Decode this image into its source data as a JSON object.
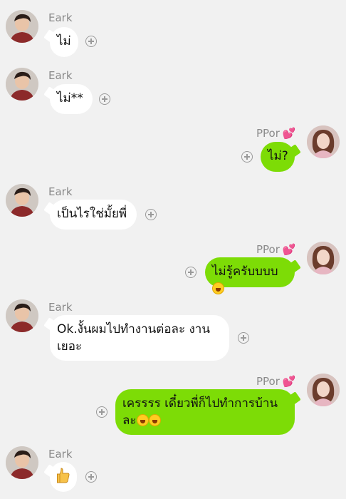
{
  "messages": [
    {
      "sender": "Eark",
      "text": "ไม่"
    },
    {
      "sender": "Eark",
      "text": "ไม่**"
    },
    {
      "sender": "PPor",
      "text": "ไม่?"
    },
    {
      "sender": "Eark",
      "text": "เป็นไรใช่มั้ยพี่"
    },
    {
      "sender": "PPor",
      "text": "ไม่รู้ครับบบบ",
      "emoji": "grinning-sweat-emoji"
    },
    {
      "sender": "Eark",
      "text": "Ok.งั้นผมไปทำงานต่อละ งาน",
      "text2": "เยอะ"
    },
    {
      "sender": "PPor",
      "text": "เครรรร เดี๋ยวพี่ก็ไปทำการบ้าน",
      "text2": "ละ",
      "emoji": "laughing-emoji"
    },
    {
      "sender": "Eark",
      "emoji": "thumbs-up-emoji"
    }
  ],
  "colors": {
    "outgoing": "#7ddc06",
    "incoming": "#ffffff",
    "background": "#f1f1f1",
    "heart": "#ff3d8b"
  },
  "icons": {
    "heart": "💕",
    "add": "plus-circle-icon"
  }
}
